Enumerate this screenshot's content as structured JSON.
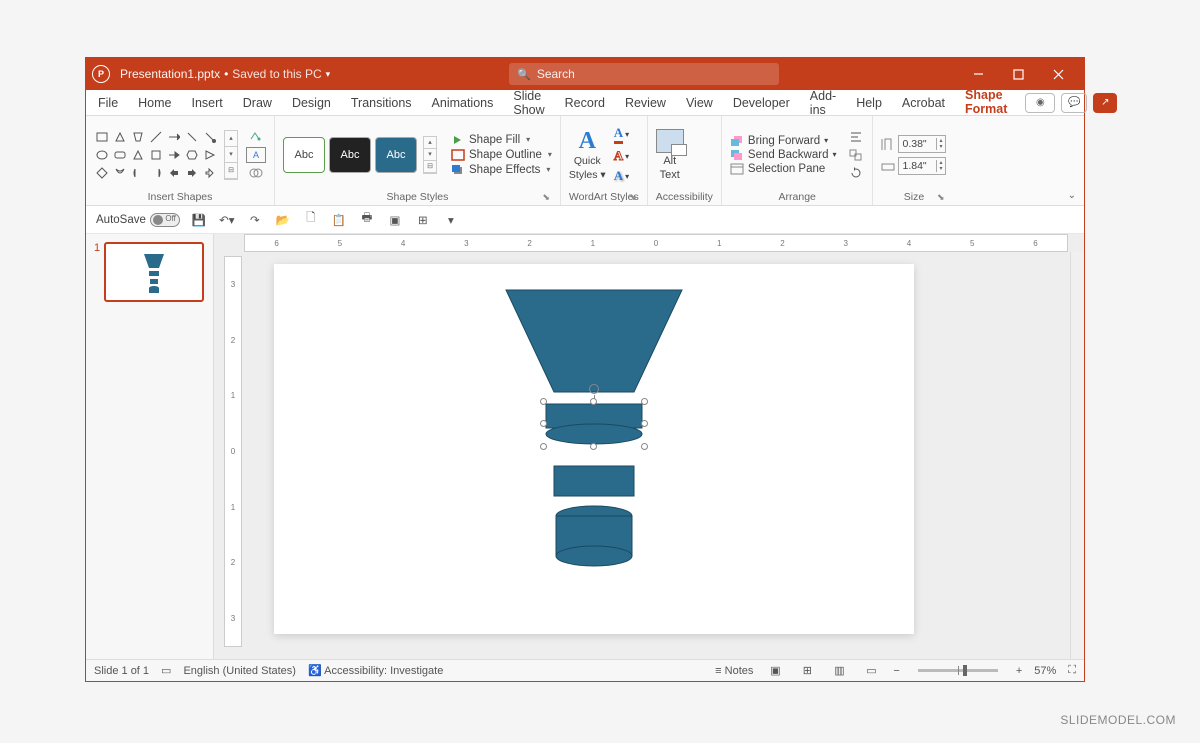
{
  "titlebar": {
    "filename": "Presentation1.pptx",
    "saved_status": "Saved to this PC",
    "search_placeholder": "Search"
  },
  "menu": {
    "tabs": [
      "File",
      "Home",
      "Insert",
      "Draw",
      "Design",
      "Transitions",
      "Animations",
      "Slide Show",
      "Record",
      "Review",
      "View",
      "Developer",
      "Add-ins",
      "Help",
      "Acrobat",
      "Shape Format"
    ],
    "active": "Shape Format"
  },
  "ribbon": {
    "insert_shapes": {
      "label": "Insert Shapes"
    },
    "shape_styles": {
      "label": "Shape Styles",
      "swatch_text": "Abc",
      "fill": "Shape Fill",
      "outline": "Shape Outline",
      "effects": "Shape Effects"
    },
    "wordart": {
      "label": "WordArt Styles",
      "quick": "Quick",
      "styles": "Styles"
    },
    "accessibility": {
      "label": "Accessibility",
      "alt": "Alt",
      "text": "Text"
    },
    "arrange": {
      "label": "Arrange",
      "bring_forward": "Bring Forward",
      "send_backward": "Send Backward",
      "selection_pane": "Selection Pane"
    },
    "size": {
      "label": "Size",
      "height": "0.38\"",
      "width": "1.84\""
    }
  },
  "qat": {
    "autosave": "AutoSave",
    "autosave_state": "Off"
  },
  "status": {
    "slide": "Slide 1 of 1",
    "language": "English (United States)",
    "accessibility": "Accessibility: Investigate",
    "notes": "Notes",
    "zoom": "57%"
  },
  "thumbnail": {
    "number": "1"
  },
  "ruler": {
    "h": [
      "6",
      "5",
      "4",
      "3",
      "2",
      "1",
      "0",
      "1",
      "2",
      "3",
      "4",
      "5",
      "6"
    ],
    "v": [
      "3",
      "2",
      "1",
      "0",
      "1",
      "2",
      "3"
    ]
  },
  "watermark": "SLIDEMODEL.COM"
}
